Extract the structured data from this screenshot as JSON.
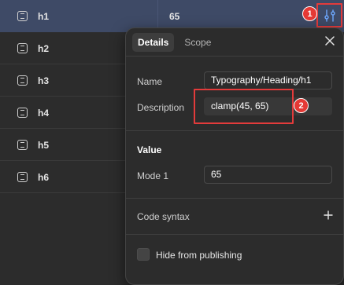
{
  "variables": [
    {
      "name": "h1",
      "value": "65"
    },
    {
      "name": "h2",
      "value": ""
    },
    {
      "name": "h3",
      "value": ""
    },
    {
      "name": "h4",
      "value": ""
    },
    {
      "name": "h5",
      "value": ""
    },
    {
      "name": "h6",
      "value": ""
    }
  ],
  "annotations": {
    "badge_1": "1",
    "badge_2": "2",
    "highlight_color": "#e33b3b",
    "badge_color": "#e53935"
  },
  "panel": {
    "tabs": [
      {
        "label": "Details",
        "active": true
      },
      {
        "label": "Scope",
        "active": false
      }
    ],
    "name_label": "Name",
    "name_value": "Typography/Heading/h1",
    "description_label": "Description",
    "description_value": "clamp(45, 65)",
    "value_section": "Value",
    "mode_label": "Mode 1",
    "mode_value": "65",
    "code_syntax_label": "Code syntax",
    "hide_label": "Hide from publishing",
    "hide_checked": false
  },
  "icons": {
    "row_icon": "number-variable-icon",
    "edit_icon": "sliders-icon",
    "close_icon": "close-icon",
    "add_icon": "plus-icon"
  },
  "colors": {
    "background": "#2c2c2c",
    "selected_row": "#3e4a66",
    "edit_icon": "#6ea8ff"
  }
}
